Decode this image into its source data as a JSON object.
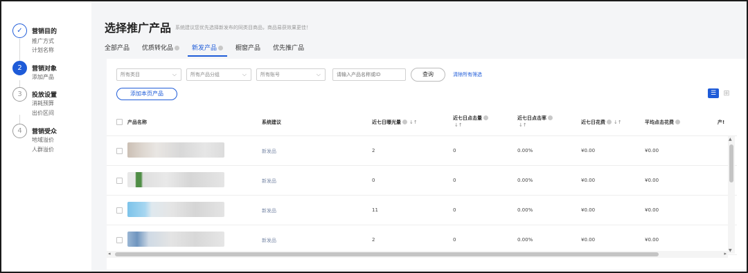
{
  "steps": [
    {
      "number": "✓",
      "title": "营销目的",
      "subs": [
        "推广方式",
        "计划名称"
      ]
    },
    {
      "number": "2",
      "title": "营销对象",
      "subs": [
        "添加产品"
      ]
    },
    {
      "number": "3",
      "title": "投放设置",
      "subs": [
        "消耗预算",
        "出价区间"
      ]
    },
    {
      "number": "4",
      "title": "营销受众",
      "subs": [
        "地域溢价",
        "人群溢价"
      ]
    }
  ],
  "header": {
    "title": "选择推广产品",
    "hint": "系统建议您优先选择新发布的同类目商品，商品易获效果更佳！"
  },
  "tabs": [
    {
      "label": "全部产品",
      "info": false
    },
    {
      "label": "优质转化品",
      "info": true
    },
    {
      "label": "新发产品",
      "info": true
    },
    {
      "label": "橱窗产品",
      "info": false
    },
    {
      "label": "优先推广品",
      "info": false
    }
  ],
  "filters": {
    "category_placeholder": "所有类目",
    "group_placeholder": "所有产品分组",
    "account_placeholder": "所有账号",
    "search_placeholder": "请输入产品名称或ID",
    "query_label": "查询",
    "clear_label": "清除所有筛选",
    "add_page_label": "添加本页产品"
  },
  "table": {
    "headers": {
      "name": "产品名称",
      "suggestion": "系统建议",
      "impressions": "近七日曝光量",
      "clicks": "近七日点击量",
      "ctr": "近七日点击率",
      "spend": "近七日花费",
      "cpc": "平均点击花费",
      "extra": "产!"
    },
    "rows": [
      {
        "tag": "新发品",
        "impressions": "2",
        "clicks": "0",
        "ctr": "0.00%",
        "spend": "¥0.00",
        "cpc": "¥0.00"
      },
      {
        "tag": "新发品",
        "impressions": "0",
        "clicks": "0",
        "ctr": "0.00%",
        "spend": "¥0.00",
        "cpc": "¥0.00"
      },
      {
        "tag": "新发品",
        "impressions": "11",
        "clicks": "0",
        "ctr": "0.00%",
        "spend": "¥0.00",
        "cpc": "¥0.00"
      },
      {
        "tag": "新发品",
        "impressions": "2",
        "clicks": "0",
        "ctr": "0.00%",
        "spend": "¥0.00",
        "cpc": "¥0.00"
      }
    ]
  },
  "colors": {
    "accent": "#1e5bd8"
  }
}
